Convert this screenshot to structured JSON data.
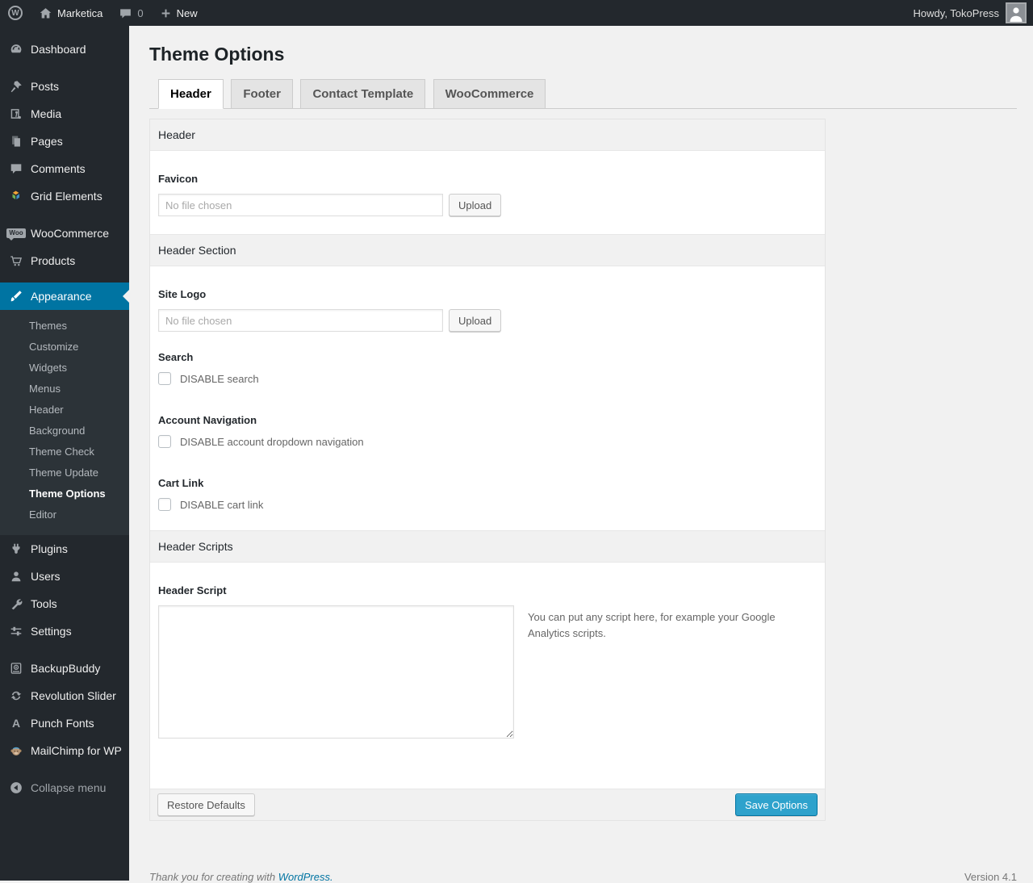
{
  "admin_bar": {
    "wp_logo_letter": "W",
    "site_name": "Marketica",
    "comment_count": "0",
    "new_label": "New",
    "howdy": "Howdy, TokoPress"
  },
  "sidebar": {
    "items": [
      {
        "label": "Dashboard"
      },
      {
        "label": "Posts"
      },
      {
        "label": "Media"
      },
      {
        "label": "Pages"
      },
      {
        "label": "Comments"
      },
      {
        "label": "Grid Elements"
      },
      {
        "label": "WooCommerce"
      },
      {
        "label": "Products"
      },
      {
        "label": "Appearance"
      },
      {
        "label": "Plugins"
      },
      {
        "label": "Users"
      },
      {
        "label": "Tools"
      },
      {
        "label": "Settings"
      },
      {
        "label": "BackupBuddy"
      },
      {
        "label": "Revolution Slider"
      },
      {
        "label": "Punch Fonts"
      },
      {
        "label": "MailChimp for WP"
      },
      {
        "label": "Collapse menu"
      }
    ],
    "woo_badge": "Woo",
    "punch_fonts_glyph": "A",
    "appearance_submenu": [
      {
        "label": "Themes"
      },
      {
        "label": "Customize"
      },
      {
        "label": "Widgets"
      },
      {
        "label": "Menus"
      },
      {
        "label": "Header"
      },
      {
        "label": "Background"
      },
      {
        "label": "Theme Check"
      },
      {
        "label": "Theme Update"
      },
      {
        "label": "Theme Options"
      },
      {
        "label": "Editor"
      }
    ]
  },
  "page": {
    "title": "Theme Options",
    "tabs": [
      {
        "label": "Header"
      },
      {
        "label": "Footer"
      },
      {
        "label": "Contact Template"
      },
      {
        "label": "WooCommerce"
      }
    ],
    "sections": {
      "header": {
        "title": "Header",
        "favicon_label": "Favicon",
        "favicon_placeholder": "No file chosen",
        "upload_label": "Upload"
      },
      "header_section": {
        "title": "Header Section",
        "site_logo_label": "Site Logo",
        "site_logo_placeholder": "No file chosen",
        "upload_label": "Upload",
        "search_label": "Search",
        "search_checkbox_label": "DISABLE search",
        "account_nav_label": "Account Navigation",
        "account_nav_checkbox_label": "DISABLE account dropdown navigation",
        "cart_link_label": "Cart Link",
        "cart_link_checkbox_label": "DISABLE cart link"
      },
      "header_scripts": {
        "title": "Header Scripts",
        "script_label": "Header Script",
        "script_value": "",
        "help_text": "You can put any script here, for example your Google Analytics scripts."
      }
    },
    "actions": {
      "restore_label": "Restore Defaults",
      "save_label": "Save Options"
    }
  },
  "footer": {
    "thanks_text": "Thank you for creating with ",
    "wordpress_link": "WordPress.",
    "version": "Version 4.1"
  },
  "colors": {
    "admin_dark": "#23282d",
    "active_menu_blue": "#0074a2",
    "primary_button_blue": "#2ea2cc"
  }
}
